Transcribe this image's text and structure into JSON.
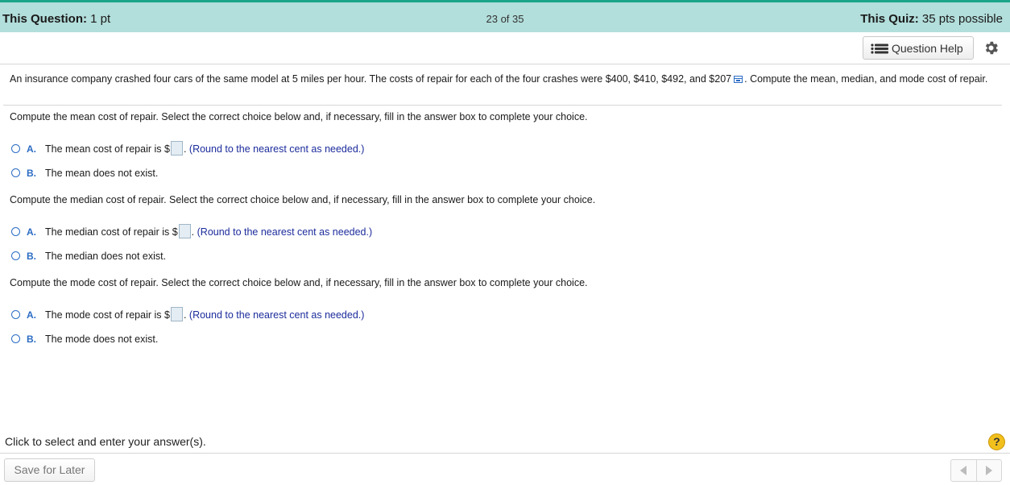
{
  "header": {
    "this_question_label": "This Question:",
    "this_question_value": "1 pt",
    "progress": "23 of 35",
    "this_quiz_label": "This Quiz:",
    "this_quiz_value": "35 pts possible"
  },
  "toolbar": {
    "question_help_label": "Question Help",
    "question_help_icon": "list-icon",
    "settings_icon": "gear-icon"
  },
  "problem": {
    "text_before_icon": "An insurance company crashed four cars of the same model at 5 miles per hour. The costs of repair for each of the four crashes were $400, $410, $492, and $207",
    "data_icon": "data-table-icon",
    "text_after_icon": ". Compute the mean, median, and mode cost of repair."
  },
  "parts": [
    {
      "prompt": "Compute the mean cost of repair. Select the correct choice below and, if necessary, fill in the answer box to complete your choice.",
      "choice_a_letter": "A.",
      "choice_a_text": "The mean cost of repair is $",
      "choice_a_suffix": ".",
      "choice_a_hint": "(Round to the nearest cent as needed.)",
      "choice_b_letter": "B.",
      "choice_b_text": "The mean does not exist."
    },
    {
      "prompt": "Compute the median cost of repair. Select the correct choice below and, if necessary, fill in the answer box to complete your choice.",
      "choice_a_letter": "A.",
      "choice_a_text": "The median cost of repair is $",
      "choice_a_suffix": ".",
      "choice_a_hint": "(Round to the nearest cent as needed.)",
      "choice_b_letter": "B.",
      "choice_b_text": "The median does not exist."
    },
    {
      "prompt": "Compute the mode cost of repair. Select the correct choice below and, if necessary, fill in the answer box to complete your choice.",
      "choice_a_letter": "A.",
      "choice_a_text": "The mode cost of repair is $",
      "choice_a_suffix": ".",
      "choice_a_hint": "(Round to the nearest cent as needed.)",
      "choice_b_letter": "B.",
      "choice_b_text": "The mode does not exist."
    }
  ],
  "footer": {
    "instruction": "Click to select and enter your answer(s).",
    "help_symbol": "?",
    "save_label": "Save for Later",
    "prev_icon": "triangle-left-icon",
    "next_icon": "triangle-right-icon"
  },
  "colors": {
    "header_bg": "#b2dedb",
    "accent_line": "#1aa58a",
    "choice_blue": "#2b6cc4",
    "hint_blue": "#1c2c9c",
    "help_yellow": "#f2c01d"
  }
}
